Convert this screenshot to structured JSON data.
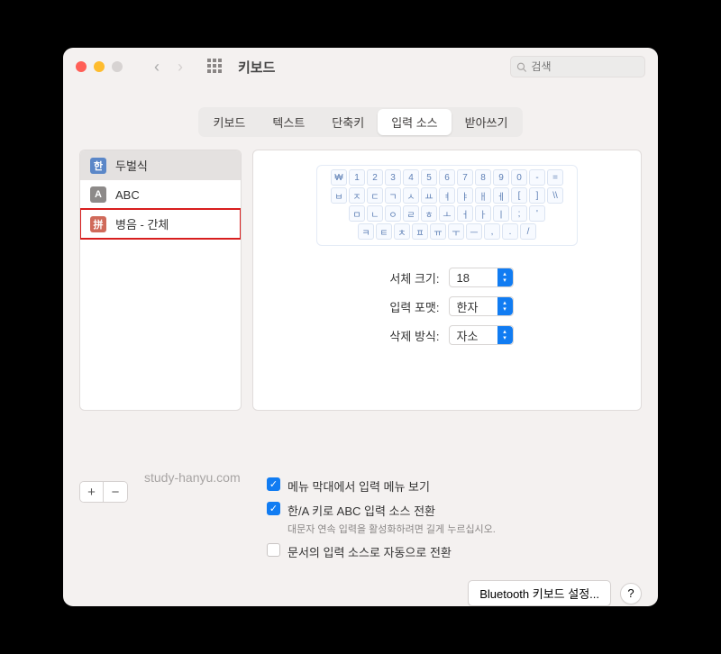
{
  "window": {
    "title": "키보드"
  },
  "search": {
    "placeholder": "검색"
  },
  "tabs": {
    "items": [
      "키보드",
      "텍스트",
      "단축키",
      "입력 소스",
      "받아쓰기"
    ],
    "active_index": 3
  },
  "sources": {
    "items": [
      {
        "badge": "한",
        "badge_color": "blue",
        "label": "두벌식",
        "selected": true
      },
      {
        "badge": "A",
        "badge_color": "gray",
        "label": "ABC",
        "selected": false
      },
      {
        "badge": "拼",
        "badge_color": "red",
        "label": "병음 - 간체",
        "selected": false,
        "highlighted": true
      }
    ]
  },
  "keyboard_preview": {
    "rows": [
      [
        "₩",
        "1",
        "2",
        "3",
        "4",
        "5",
        "6",
        "7",
        "8",
        "9",
        "0",
        "-",
        "="
      ],
      [
        "ㅂ",
        "ㅈ",
        "ㄷ",
        "ㄱ",
        "ㅅ",
        "ㅛ",
        "ㅕ",
        "ㅑ",
        "ㅐ",
        "ㅔ",
        "[",
        "]",
        "\\\\"
      ],
      [
        "ㅁ",
        "ㄴ",
        "ㅇ",
        "ㄹ",
        "ㅎ",
        "ㅗ",
        "ㅓ",
        "ㅏ",
        "ㅣ",
        ";",
        "'"
      ],
      [
        "ㅋ",
        "ㅌ",
        "ㅊ",
        "ㅍ",
        "ㅠ",
        "ㅜ",
        "ㅡ",
        ",",
        ".",
        "/"
      ]
    ]
  },
  "settings": {
    "font_size": {
      "label": "서체 크기:",
      "value": "18"
    },
    "input_format": {
      "label": "입력 포맷:",
      "value": "한자"
    },
    "delete_mode": {
      "label": "삭제 방식:",
      "value": "자소"
    }
  },
  "checkboxes": {
    "show_menu": {
      "checked": true,
      "label": "메뉴 막대에서 입력 메뉴 보기"
    },
    "switch_abc": {
      "checked": true,
      "label": "한/A 키로 ABC 입력 소스 전환",
      "sub": "대문자 연속 입력을 활성화하려면 길게 누르십시오."
    },
    "auto_switch": {
      "checked": false,
      "label": "문서의 입력 소스로 자동으로 전환"
    }
  },
  "footer": {
    "bluetooth_btn": "Bluetooth 키보드 설정...",
    "help": "?"
  },
  "watermark": "study-hanyu.com"
}
